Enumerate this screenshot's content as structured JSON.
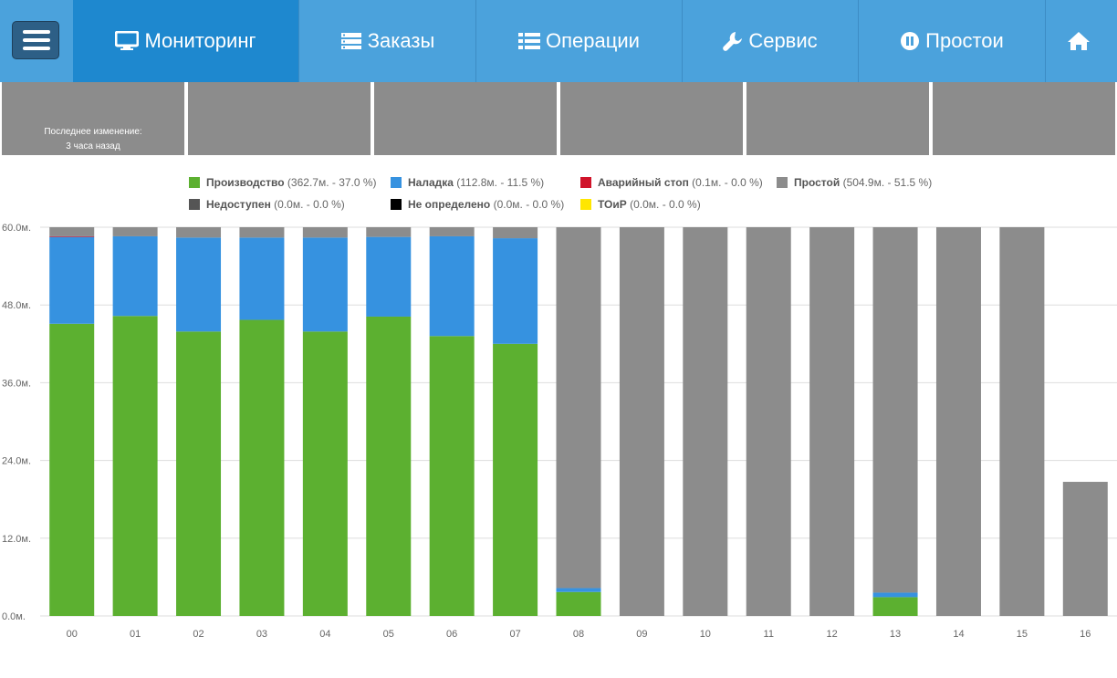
{
  "nav": {
    "items": [
      {
        "label": "Мониторинг",
        "icon": "monitor-icon",
        "active": true
      },
      {
        "label": "Заказы",
        "icon": "server-icon"
      },
      {
        "label": "Операции",
        "icon": "list-icon"
      },
      {
        "label": "Сервис",
        "icon": "wrench-icon"
      },
      {
        "label": "Простои",
        "icon": "pause-icon"
      }
    ],
    "home_icon": "home-icon",
    "menu_icon": "hamburger-icon"
  },
  "tiles": {
    "first": {
      "line1": "Последнее изменение:",
      "line2": "3 часа назад"
    }
  },
  "legend": [
    {
      "name": "Производство",
      "detail": "(362.7м. - 37.0 %)",
      "color": "#5cb030"
    },
    {
      "name": "Наладка",
      "detail": "(112.8м. - 11.5 %)",
      "color": "#3692e0"
    },
    {
      "name": "Аварийный стоп",
      "detail": "(0.1м. - 0.0 %)",
      "color": "#d0142a"
    },
    {
      "name": "Простой",
      "detail": "(504.9м. - 51.5 %)",
      "color": "#8c8c8c"
    },
    {
      "name": "Недоступен",
      "detail": "(0.0м. - 0.0 %)",
      "color": "#555555"
    },
    {
      "name": "Не определено",
      "detail": "(0.0м. - 0.0 %)",
      "color": "#000000"
    },
    {
      "name": "ТОиР",
      "detail": "(0.0м. - 0.0 %)",
      "color": "#ffe600"
    }
  ],
  "chart_data": {
    "type": "bar",
    "stacked": true,
    "categories": [
      "00",
      "01",
      "02",
      "03",
      "04",
      "05",
      "06",
      "07",
      "08",
      "09",
      "10",
      "11",
      "12",
      "13",
      "14",
      "15",
      "16"
    ],
    "y_ticks": [
      "0.0м.",
      "12.0м.",
      "24.0м.",
      "36.0м.",
      "48.0м.",
      "60.0м."
    ],
    "ylim": [
      0,
      60
    ],
    "grid": true,
    "series": [
      {
        "name": "Производство",
        "color": "#5cb030",
        "values": [
          45.1,
          46.3,
          43.9,
          45.7,
          43.9,
          46.2,
          43.2,
          42.0,
          3.7,
          0,
          0,
          0,
          0,
          2.9,
          0,
          0,
          0
        ]
      },
      {
        "name": "Наладка",
        "color": "#3692e0",
        "values": [
          13.4,
          12.3,
          14.5,
          12.7,
          14.5,
          12.3,
          15.4,
          16.3,
          0.6,
          0,
          0,
          0,
          0,
          0.7,
          0,
          0,
          0
        ]
      },
      {
        "name": "Аварийный стоп",
        "color": "#d0142a",
        "values": [
          0.1,
          0,
          0,
          0,
          0,
          0,
          0,
          0,
          0,
          0,
          0,
          0,
          0,
          0,
          0,
          0,
          0
        ]
      },
      {
        "name": "Простой",
        "color": "#8c8c8c",
        "values": [
          1.4,
          1.4,
          1.6,
          1.6,
          1.6,
          1.5,
          1.4,
          1.7,
          55.7,
          60,
          60,
          60,
          60,
          56.4,
          60,
          60,
          20.7
        ]
      }
    ]
  }
}
